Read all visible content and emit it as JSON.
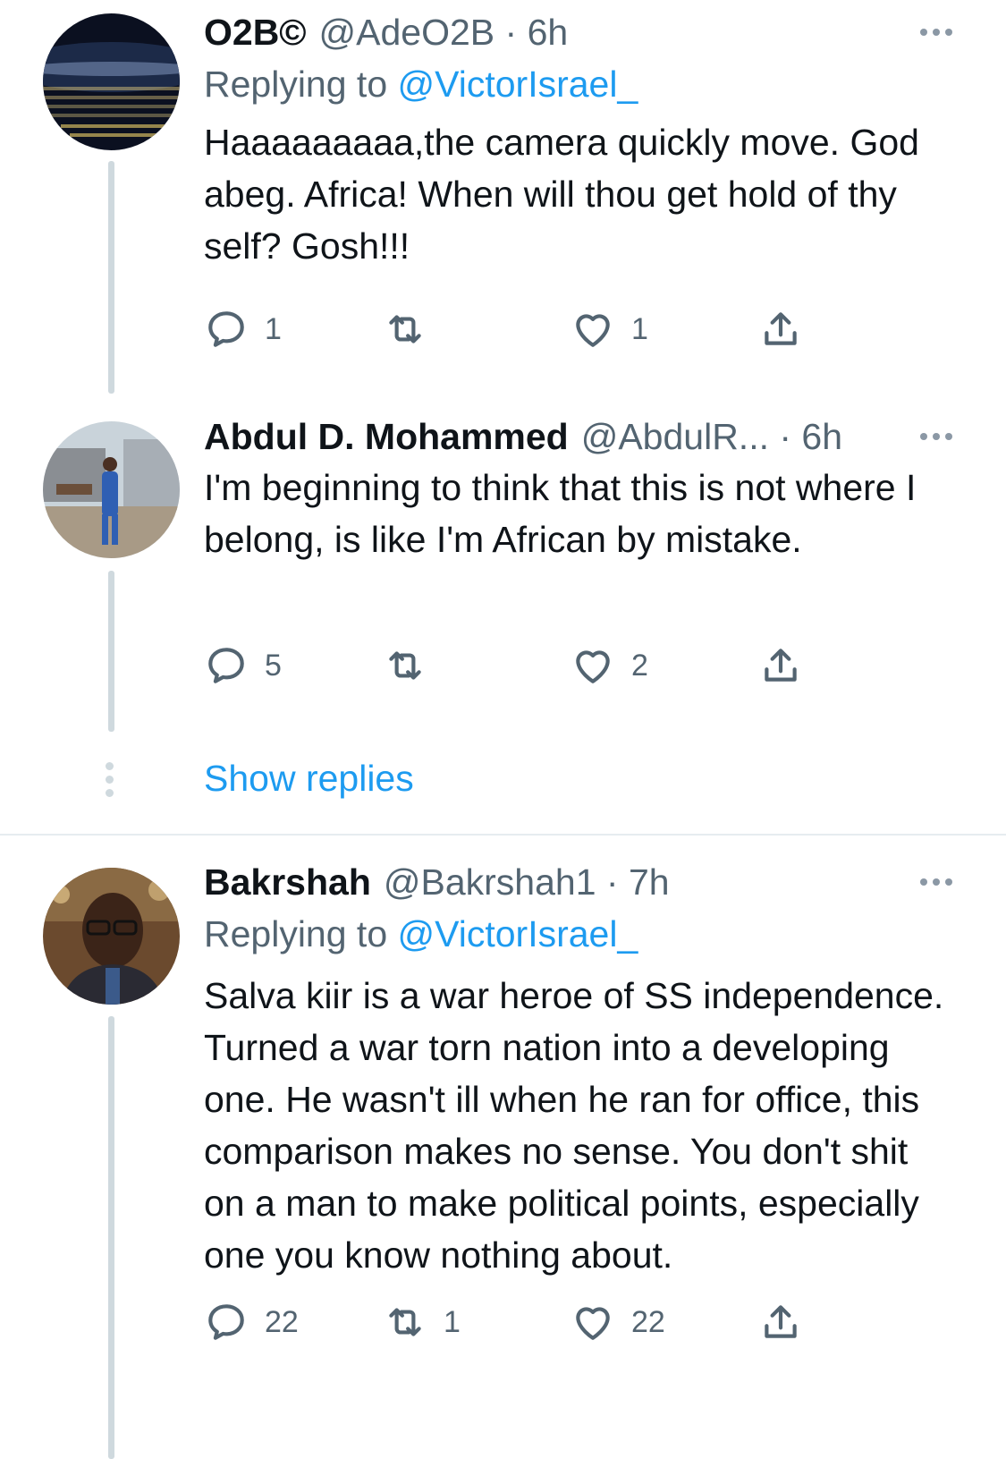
{
  "tweets": [
    {
      "name": "O2B©",
      "handle": "@AdeO2B · 6h",
      "replying_label": "Replying to",
      "replying_to": "@VictorIsrael_",
      "text": "Haaaaaaaaa,the camera quickly move. God abeg. Africa! When will thou get hold of thy self? Gosh!!!",
      "replies": "1",
      "retweets": "",
      "likes": "1",
      "avatar_colors": [
        "#0b1020",
        "#1c2a48",
        "#f2d36b"
      ]
    },
    {
      "name": "Abdul D. Mohammed",
      "handle": "@AbdulR... · 6h",
      "text": "I'm beginning to think that this is not where I belong, is like I'm African by mistake.",
      "replies": "5",
      "retweets": "",
      "likes": "2",
      "avatar_colors": [
        "#c9d3da",
        "#2f5fb3",
        "#7c6a55"
      ]
    },
    {
      "name": "Bakrshah",
      "handle": "@Bakrshah1 · 7h",
      "replying_label": "Replying to",
      "replying_to": "@VictorIsrael_",
      "text": "Salva kiir is a war heroe of SS independence. Turned a war torn nation into a developing one. He wasn't ill when he ran for office, this comparison makes no sense. You don't shit on a man to make political points, especially one you know nothing about.",
      "replies": "22",
      "retweets": "1",
      "likes": "22",
      "avatar_colors": [
        "#6b4a2e",
        "#2a2a33",
        "#b8864e"
      ]
    }
  ],
  "show_replies": "Show replies",
  "icons": {
    "reply": "reply-icon",
    "retweet": "retweet-icon",
    "like": "heart-icon",
    "share": "share-icon",
    "more": "more-icon"
  },
  "colors": {
    "link": "#1d9bf0",
    "secondary": "#536471",
    "text": "#0f1419",
    "thread_line": "#cfd9de"
  }
}
